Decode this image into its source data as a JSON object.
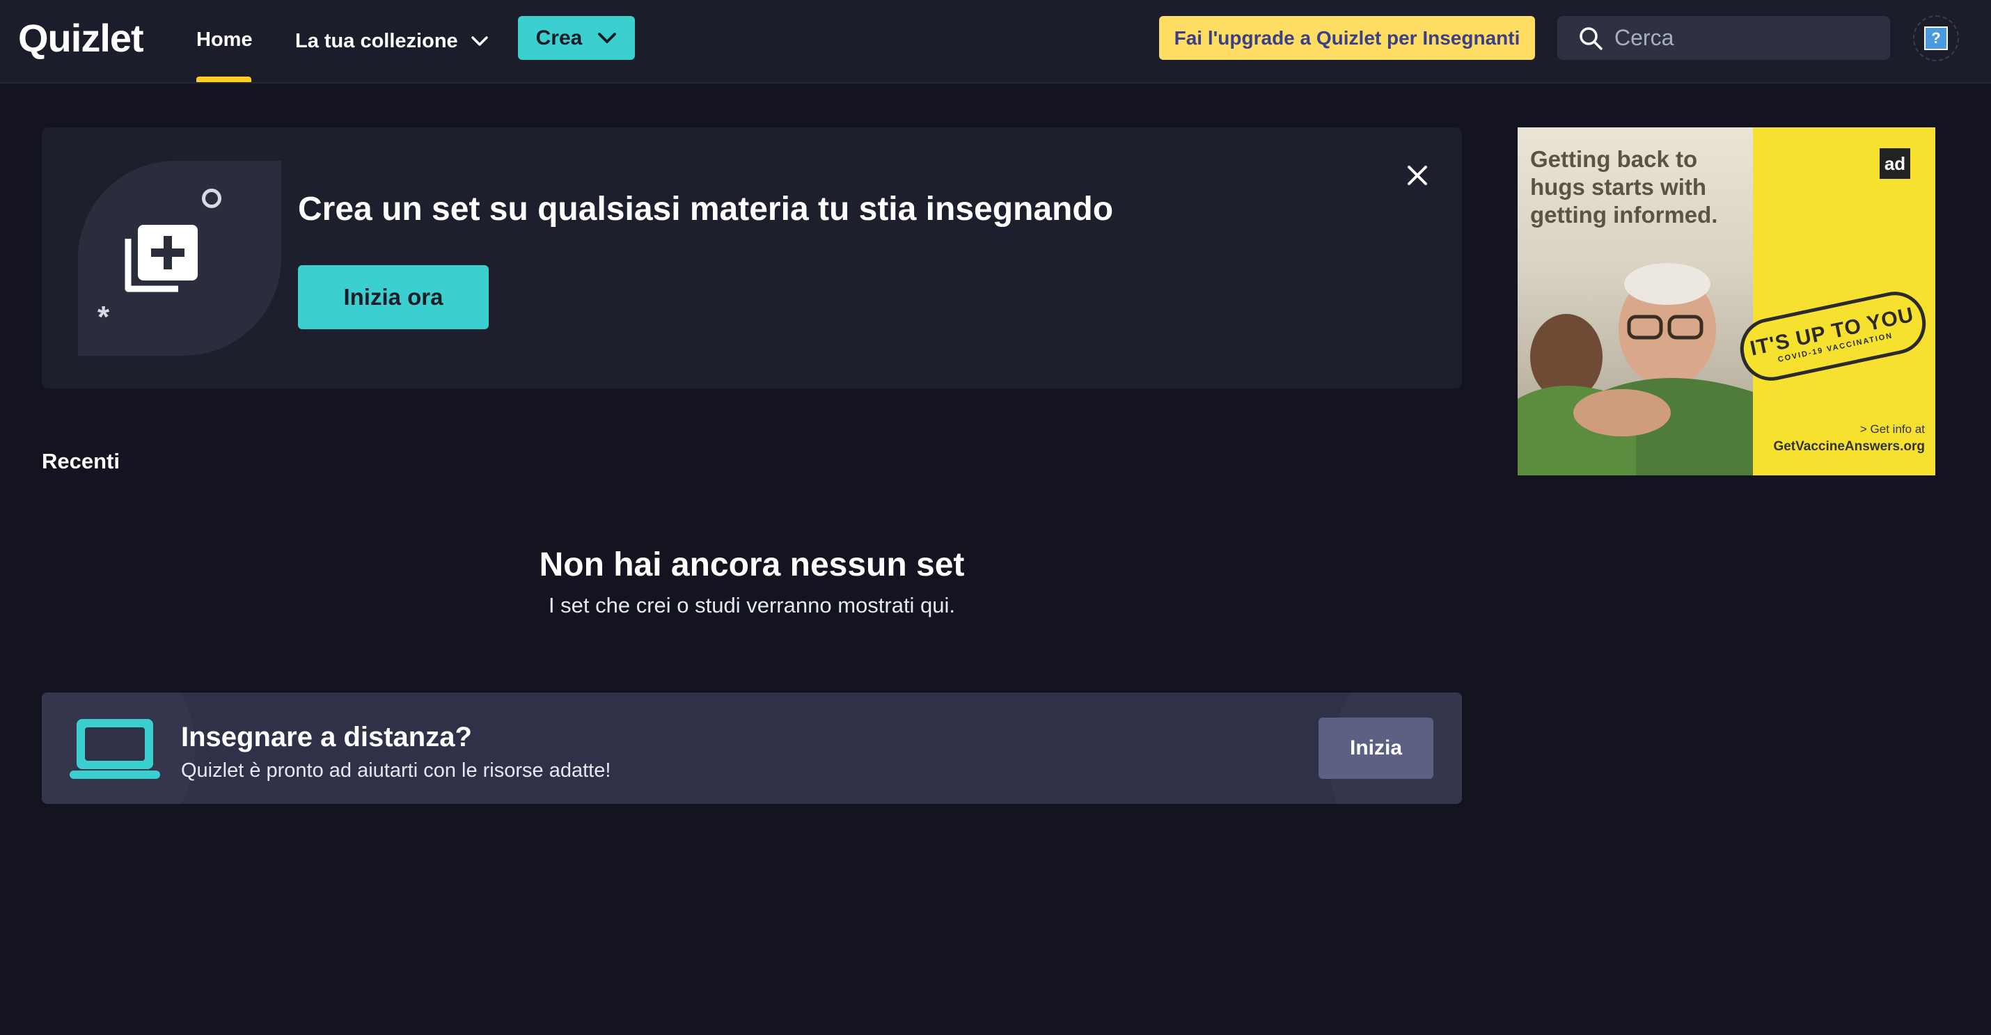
{
  "header": {
    "logo": "Quizlet",
    "nav": {
      "home_label": "Home",
      "collection_label": "La tua collezione",
      "create_label": "Crea"
    },
    "upgrade_label": "Fai l'upgrade a Quizlet per Insegnanti",
    "search": {
      "placeholder": "Cerca",
      "value": ""
    },
    "accent_color": "#ffcd1f",
    "create_color": "#3ccfcf",
    "upgrade_color": "#ffdc62"
  },
  "banner": {
    "icon": "add-set-icon",
    "title": "Crea un set su qualsiasi materia tu stia insegnando",
    "cta_label": "Inizia ora",
    "close_icon": "close-icon"
  },
  "recent": {
    "label": "Recenti",
    "empty_title": "Non hai ancora nessun set",
    "empty_subtitle": "I set che crei o studi verranno mostrati qui."
  },
  "remote_teaching": {
    "icon": "laptop-icon",
    "title": "Insegnare a distanza?",
    "subtitle": "Quizlet è pronto ad aiutarti con le risorse adatte!",
    "button_label": "Inizia"
  },
  "ad": {
    "headline": "Getting back to hugs starts with getting informed.",
    "logo_text": "ad",
    "stamp_main": "IT'S UP TO YOU",
    "stamp_sub": "COVID-19 VACCINATION",
    "info_text": "> Get info at",
    "url_text": "GetVaccineAnswers.org"
  }
}
